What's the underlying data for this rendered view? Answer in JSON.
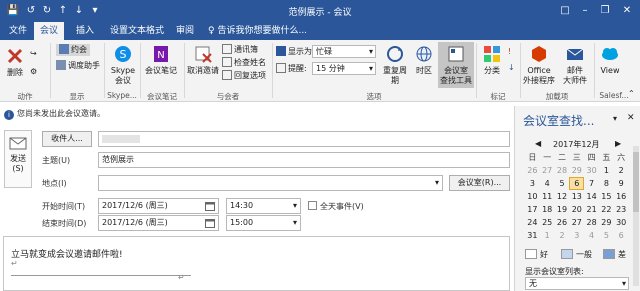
{
  "titlebar": {
    "title": "范例展示 - 会议",
    "colors": {
      "accent": "#2b579a"
    }
  },
  "tabs": [
    {
      "label": "文件"
    },
    {
      "label": "会议"
    },
    {
      "label": "插入"
    },
    {
      "label": "设置文本格式"
    },
    {
      "label": "审阅"
    }
  ],
  "tell_me": "♀ 告诉我你想要做什么...",
  "ribbon": {
    "delete_label": "删除",
    "cal_label": "约会",
    "sched_label": "调度助手",
    "show_group": "显示",
    "actions_group": "动作",
    "skype_label1": "Skype",
    "skype_label2": "会议",
    "skype_group": "Skype...",
    "notes_label": "会议笔记",
    "notes_group": "会议笔记",
    "cancel_label": "取消邀请",
    "addr_label": "通讯簿",
    "check_label": "检查姓名",
    "resp_label": "回复选项",
    "attendees_group": "与会者",
    "show_as_label": "显示为:",
    "show_as_value": "忙碌",
    "remind_label": "提醒:",
    "remind_value": "15 分钟",
    "recur_label": "重复周期",
    "tz_label": "时区",
    "room_label1": "会议室",
    "room_label2": "查找工具",
    "options_group": "选项",
    "cat_label": "分类",
    "tags_group": "标记",
    "office_label1": "Office",
    "office_label2": "外接程序",
    "mail_label1": "邮件",
    "mail_label2": "大师件",
    "addins_group": "加载项",
    "view_label": "View",
    "sales_group": "Salesf..."
  },
  "info": "您尚未发出此会议邀请。",
  "form": {
    "send_label": "发送",
    "send_sub": "(S)",
    "to_btn": "收件人...",
    "subject_label": "主题(U)",
    "subject_value": "范例展示",
    "location_label": "地点(I)",
    "room_btn": "会议室(R)...",
    "start_label": "开始时间(T)",
    "start_date": "2017/12/6 (周三)",
    "start_time": "14:30",
    "allday_label": "全天事件(V)",
    "end_label": "结束时间(D)",
    "end_date": "2017/12/6 (周三)",
    "end_time": "15:00"
  },
  "body": {
    "text": "立马就变成会议邀请邮件啦!"
  },
  "room_finder": {
    "title": "会议室查找...",
    "month": "2017年12月",
    "weekdays": [
      "日",
      "一",
      "二",
      "三",
      "四",
      "五",
      "六"
    ],
    "weeks": [
      [
        "26",
        "27",
        "28",
        "29",
        "30",
        "1",
        "2"
      ],
      [
        "3",
        "4",
        "5",
        "6",
        "7",
        "8",
        "9"
      ],
      [
        "10",
        "11",
        "12",
        "13",
        "14",
        "15",
        "16"
      ],
      [
        "17",
        "18",
        "19",
        "20",
        "21",
        "22",
        "23"
      ],
      [
        "24",
        "25",
        "26",
        "27",
        "28",
        "29",
        "30"
      ],
      [
        "31",
        "1",
        "2",
        "3",
        "4",
        "5",
        "6"
      ]
    ],
    "legend": {
      "good": "好",
      "fair": "一般",
      "poor": "差"
    },
    "list_label": "显示会议室列表:",
    "list_value": "无"
  }
}
